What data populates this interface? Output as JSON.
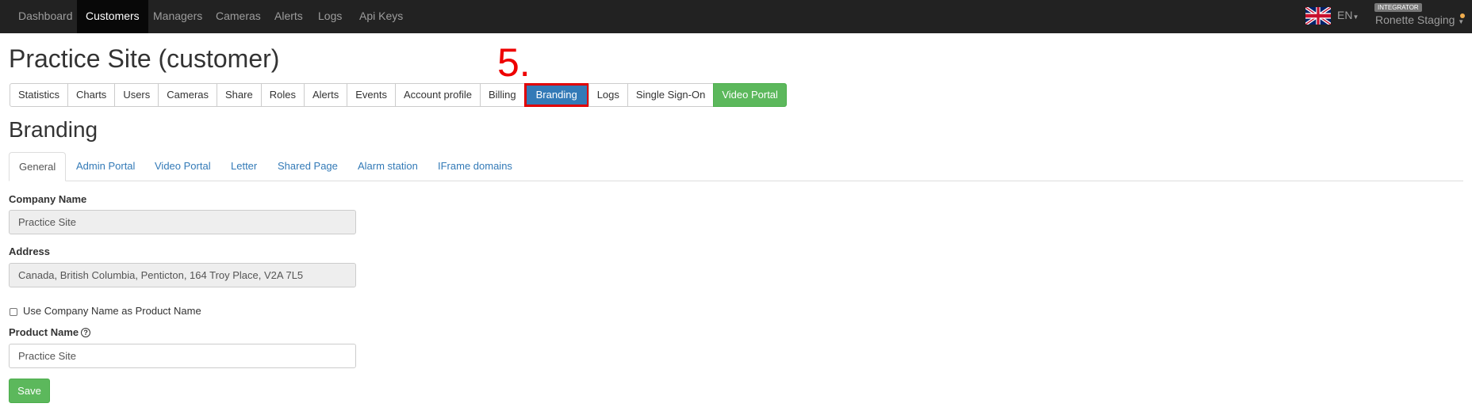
{
  "navbar": {
    "items": [
      "Dashboard",
      "Customers",
      "Managers",
      "Cameras",
      "Alerts",
      "Logs",
      "Api Keys"
    ],
    "active": "Customers",
    "language": "EN",
    "role_badge": "INTEGRATOR",
    "user_name": "Ronette Staging"
  },
  "page": {
    "title": "Practice Site (customer)",
    "step_marker": "5."
  },
  "pills": {
    "items": [
      "Statistics",
      "Charts",
      "Users",
      "Cameras",
      "Share",
      "Roles",
      "Alerts",
      "Events",
      "Account profile",
      "Billing",
      "Branding",
      "Logs",
      "Single Sign-On",
      "Video Portal"
    ],
    "active": "Branding"
  },
  "section": {
    "title": "Branding"
  },
  "tabs": {
    "items": [
      "General",
      "Admin Portal",
      "Video Portal",
      "Letter",
      "Shared Page",
      "Alarm station",
      "IFrame domains"
    ],
    "active": "General"
  },
  "form": {
    "company_name_label": "Company Name",
    "company_name_value": "Practice Site",
    "address_label": "Address",
    "address_value": "Canada, British Columbia, Penticton, 164 Troy Place, V2A 7L5",
    "use_company_name_label": "Use Company Name as Product Name",
    "use_company_name_checked": false,
    "product_name_label": "Product Name",
    "product_name_value": "Practice Site",
    "save_label": "Save"
  },
  "colors": {
    "navbar_bg": "#222222",
    "primary": "#337ab7",
    "success": "#5cb85c",
    "highlight": "#e00000"
  }
}
